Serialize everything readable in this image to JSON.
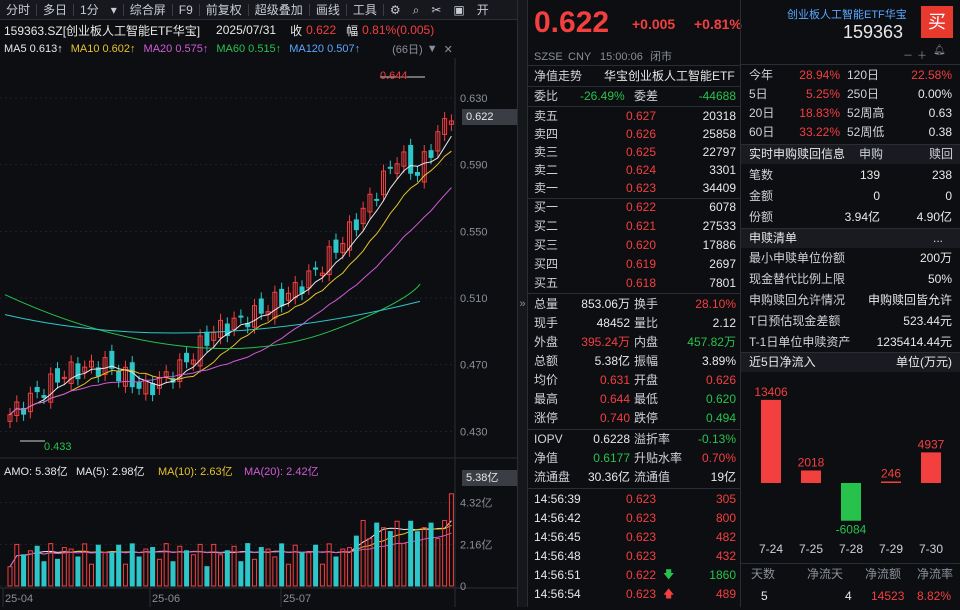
{
  "toolbar": {
    "items": [
      "分时",
      "多日",
      "1分",
      "综合屏",
      "F9",
      "前复权",
      "超级叠加",
      "画线",
      "工具"
    ],
    "extra": "开"
  },
  "header": {
    "code_name": "159363.SZ[创业板人工智能ETF华宝]",
    "date": "2025/07/31",
    "close_label": "收",
    "close": "0.622",
    "chg_label": "幅",
    "chg": "0.81%(0.005)"
  },
  "ma": {
    "ma5": "MA5 0.613↑",
    "ma10": "MA10 0.602↑",
    "ma20": "MA20 0.575↑",
    "ma60": "MA60 0.515↑",
    "ma120": "MA120 0.507↑",
    "days": "(66日)"
  },
  "chart": {
    "high_label": "0.644",
    "low_label": "0.433",
    "current_label": "0.622",
    "price_ticks": [
      "0.630",
      "0.590",
      "0.550",
      "0.510",
      "0.470",
      "0.430"
    ],
    "amo": "AMO: 5.38亿",
    "amo_ma5": "MA(5): 2.98亿",
    "amo_ma10": "MA(10): 2.63亿",
    "amo_ma20": "MA(20): 2.42亿",
    "vol_ticks": [
      "4.32亿",
      "2.16亿",
      "0"
    ],
    "vol_current": "5.38亿",
    "x_labels": [
      "25-04",
      "25-06",
      "25-07"
    ]
  },
  "quote": {
    "price": "0.622",
    "change": "+0.005",
    "change_pct": "+0.81%",
    "exchange": "SZSE",
    "currency": "CNY",
    "time": "15:00:06",
    "status": "闭市",
    "trend_label": "净值走势",
    "fund_name": "华宝创业板人工智能ETF",
    "webi_label": "委比",
    "webi": "-26.49%",
    "weicha_label": "委差",
    "weicha": "-44688",
    "asks": [
      {
        "l": "卖五",
        "p": "0.627",
        "v": "20318"
      },
      {
        "l": "卖四",
        "p": "0.626",
        "v": "25858"
      },
      {
        "l": "卖三",
        "p": "0.625",
        "v": "22797"
      },
      {
        "l": "卖二",
        "p": "0.624",
        "v": "3301"
      },
      {
        "l": "卖一",
        "p": "0.623",
        "v": "34409"
      }
    ],
    "bids": [
      {
        "l": "买一",
        "p": "0.622",
        "v": "6078"
      },
      {
        "l": "买二",
        "p": "0.621",
        "v": "27533"
      },
      {
        "l": "买三",
        "p": "0.620",
        "v": "17886"
      },
      {
        "l": "买四",
        "p": "0.619",
        "v": "2697"
      },
      {
        "l": "买五",
        "p": "0.618",
        "v": "7801"
      }
    ],
    "stats": [
      {
        "a": "总量",
        "b": "853.06万",
        "c": "换手",
        "d": "28.10%"
      },
      {
        "a": "现手",
        "b": "48452",
        "c": "量比",
        "d": "2.12"
      },
      {
        "a": "外盘",
        "b": "395.24万",
        "c": "内盘",
        "d": "457.82万"
      },
      {
        "a": "总额",
        "b": "5.38亿",
        "c": "振幅",
        "d": "3.89%"
      },
      {
        "a": "均价",
        "b": "0.631",
        "c": "开盘",
        "d": "0.626"
      },
      {
        "a": "最高",
        "b": "0.644",
        "c": "最低",
        "d": "0.620"
      },
      {
        "a": "涨停",
        "b": "0.740",
        "c": "跌停",
        "d": "0.494"
      }
    ],
    "iopv": [
      {
        "a": "IOPV",
        "b": "0.6228",
        "c": "溢折率",
        "d": "-0.13%"
      },
      {
        "a": "净值",
        "b": "0.6177",
        "c": "升贴水率",
        "d": "0.70%"
      },
      {
        "a": "流通盘",
        "b": "30.36亿",
        "c": "流通值",
        "d": "19亿"
      }
    ],
    "ticks": [
      {
        "t": "14:56:39",
        "p": "0.623",
        "v": "305"
      },
      {
        "t": "14:56:42",
        "p": "0.623",
        "v": "800"
      },
      {
        "t": "14:56:45",
        "p": "0.623",
        "v": "482"
      },
      {
        "t": "14:56:48",
        "p": "0.623",
        "v": "432"
      },
      {
        "t": "14:56:51",
        "p": "0.622",
        "v": "1860",
        "arrow": "down"
      },
      {
        "t": "14:56:54",
        "p": "0.623",
        "v": "489",
        "arrow": "up"
      }
    ]
  },
  "info": {
    "title": "创业板人工智能ETF华宝",
    "code": "159363",
    "buy_btn": "买",
    "perf": [
      {
        "a": "今年",
        "b": "28.94%",
        "c": "120日",
        "d": "22.58%"
      },
      {
        "a": "5日",
        "b": "5.25%",
        "c": "250日",
        "d": "0.00%"
      },
      {
        "a": "20日",
        "b": "18.83%",
        "c": "52周高",
        "d": "0.63"
      },
      {
        "a": "60日",
        "b": "33.22%",
        "c": "52周低",
        "d": "0.38"
      }
    ],
    "sub_header": {
      "a": "实时申购赎回信息",
      "b": "申购",
      "c": "赎回"
    },
    "sub": [
      {
        "a": "笔数",
        "b": "139",
        "c": "238"
      },
      {
        "a": "金额",
        "b": "0",
        "c": "0"
      },
      {
        "a": "份额",
        "b": "3.94亿",
        "c": "4.90亿"
      }
    ],
    "list_title": "申赎清单",
    "more": "...",
    "list": [
      {
        "a": "最小申赎单位份额",
        "b": "200万"
      },
      {
        "a": "现金替代比例上限",
        "b": "50%"
      },
      {
        "a": "申购赎回允许情况",
        "b": "申购赎回皆允许"
      },
      {
        "a": "T日预估现金差额",
        "b": "523.44元"
      },
      {
        "a": "T-1日单位申赎资产",
        "b": "1235414.44元"
      }
    ],
    "flow_title": "近5日净流入",
    "flow_unit": "单位(万元)",
    "flow": [
      {
        "d": "7-24",
        "v": 13406
      },
      {
        "d": "7-25",
        "v": 2018
      },
      {
        "d": "7-28",
        "v": -6084
      },
      {
        "d": "7-29",
        "v": 246
      },
      {
        "d": "7-30",
        "v": 4937
      }
    ],
    "foot_head": [
      "天数",
      "净流天",
      "净流额",
      "净流率"
    ],
    "foot": [
      "5",
      "4",
      "14523",
      "8.82%"
    ]
  },
  "colors": {
    "up": "#f43f3f",
    "down": "#27c24c",
    "bg": "#0d0e12"
  }
}
